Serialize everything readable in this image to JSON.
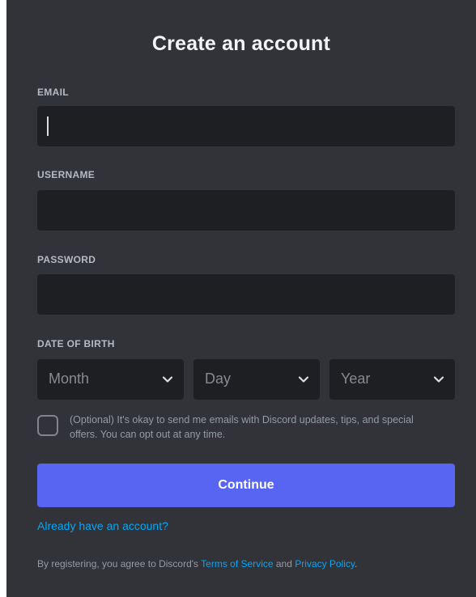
{
  "title": "Create an account",
  "email": {
    "label": "EMAIL",
    "value": ""
  },
  "username": {
    "label": "USERNAME",
    "value": ""
  },
  "password": {
    "label": "PASSWORD",
    "value": ""
  },
  "dob": {
    "label": "DATE OF BIRTH",
    "month_placeholder": "Month",
    "day_placeholder": "Day",
    "year_placeholder": "Year",
    "chevron_icon": "chevron-down-icon"
  },
  "optin": {
    "checked": false,
    "text": "(Optional) It's okay to send me emails with Discord updates, tips, and special offers. You can opt out at any time."
  },
  "continue_label": "Continue",
  "login_link": "Already have an account?",
  "legal": {
    "prefix": "By registering, you agree to Discord's ",
    "terms": "Terms of Service",
    "middle": " and ",
    "privacy": "Privacy Policy",
    "suffix": "."
  },
  "colors": {
    "background": "#313338",
    "input": "#1e1f22",
    "accent": "#5865f2",
    "link": "#00a8fc"
  }
}
